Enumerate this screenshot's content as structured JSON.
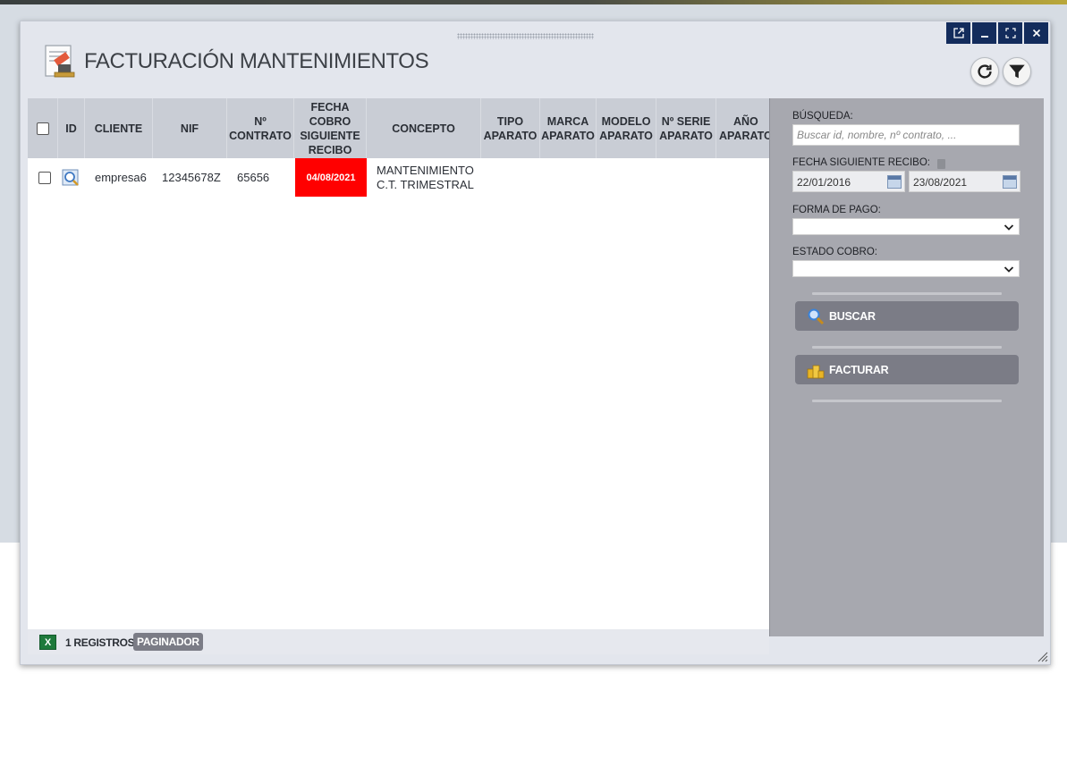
{
  "window": {
    "title": "FACTURACIÓN MANTENIMIENTOS",
    "controls": [
      "popout-icon",
      "minimize-icon",
      "maximize-icon",
      "close-icon"
    ],
    "close_label": "✕",
    "minimize_label": "_"
  },
  "toolbar": {
    "refresh_icon": "refresh-icon",
    "filter_icon": "filter-icon"
  },
  "grid": {
    "columns": [
      "ID",
      "CLIENTE",
      "NIF",
      "Nº CONTRATO",
      "FECHA COBRO SIGUIENTE RECIBO",
      "CONCEPTO",
      "TIPO APARATO",
      "MARCA APARATO",
      "MODELO APARATO",
      "Nº SERIE APARATO",
      "AÑO APARATO"
    ],
    "col_labels": {
      "id": "ID",
      "cliente": "CLIENTE",
      "nif": "NIF",
      "contrato_l1": "Nº",
      "contrato_l2": "CONTRATO",
      "fecha_l1": "FECHA",
      "fecha_l2": "COBRO",
      "fecha_l3": "SIGUIENTE",
      "fecha_l4": "RECIBO",
      "concepto": "CONCEPTO",
      "tipo_l1": "TIPO",
      "tipo_l2": "APARATO",
      "marca_l1": "MARCA",
      "marca_l2": "APARATO",
      "modelo_l1": "MODELO",
      "modelo_l2": "APARATO",
      "serie_l1": "Nº SERIE",
      "serie_l2": "APARATO",
      "anio_l1": "AÑO",
      "anio_l2": "APARATO"
    },
    "rows": [
      {
        "cliente": "empresa6",
        "nif": "12345678Z",
        "contrato": "65656",
        "fecha": "04/08/2021",
        "concepto_l1": "MANTENIMIENTO",
        "concepto_l2": "C.T. TRIMESTRAL"
      }
    ],
    "overdue_color": "#ff0000"
  },
  "filters": {
    "busqueda_label": "BÚSQUEDA:",
    "busqueda_placeholder": "Buscar id, nombre, nº contrato, ...",
    "fecha_label": "FECHA SIGUIENTE RECIBO:",
    "fecha_desde": "22/01/2016",
    "fecha_hasta": "23/08/2021",
    "forma_pago_label": "FORMA DE PAGO:",
    "forma_pago_value": "",
    "estado_cobro_label": "ESTADO COBRO:",
    "estado_cobro_value": "",
    "buscar_label": "BUSCAR",
    "facturar_label": "FACTURAR"
  },
  "footer": {
    "excel_icon": "excel-export-icon",
    "registros": "1 REGISTROS",
    "paginador": "PAGINADOR"
  },
  "colors": {
    "window_controls": "#132c5c",
    "side_panel": "#a7a8af",
    "action_button": "#7b7c86",
    "header_bg": "#c9cdd5"
  }
}
